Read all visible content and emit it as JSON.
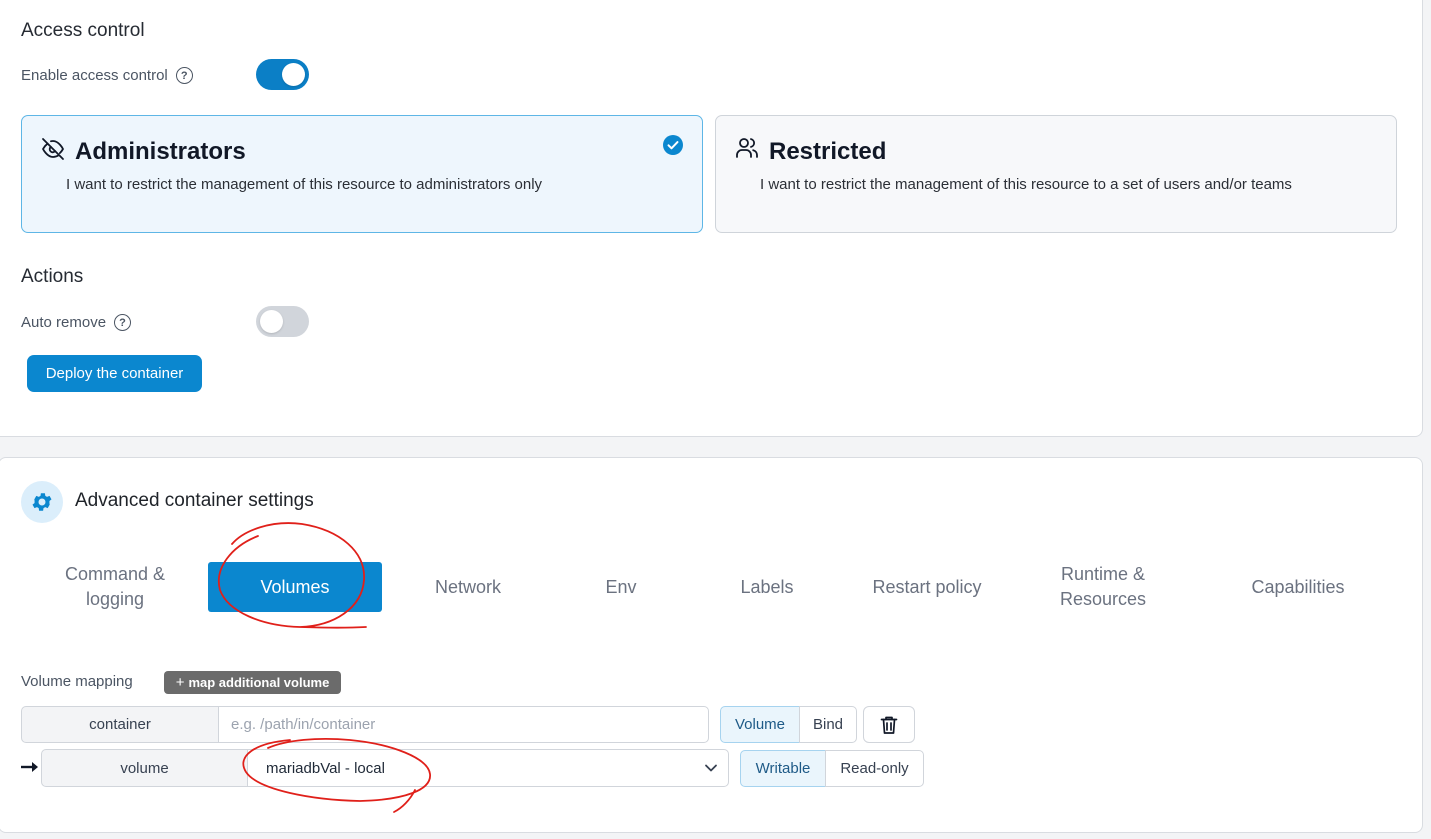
{
  "access_control": {
    "title": "Access control",
    "enable_label": "Enable access control",
    "enabled": true,
    "help_glyph": "?"
  },
  "cards": {
    "administrators": {
      "title": "Administrators",
      "description": "I want to restrict the management of this resource to administrators only",
      "icon": "eye-off-icon",
      "selected": true
    },
    "restricted": {
      "title": "Restricted",
      "description": "I want to restrict the management of this resource to a set of users and/or teams",
      "icon": "users-icon",
      "selected": false
    }
  },
  "actions": {
    "title": "Actions",
    "auto_remove_label": "Auto remove",
    "auto_remove_enabled": false,
    "help_glyph": "?",
    "deploy_button": "Deploy the container"
  },
  "advanced": {
    "title": "Advanced container settings",
    "icon": "gear-icon",
    "tabs": [
      {
        "label": "Command & logging",
        "active": false
      },
      {
        "label": "Volumes",
        "active": true
      },
      {
        "label": "Network",
        "active": false
      },
      {
        "label": "Env",
        "active": false
      },
      {
        "label": "Labels",
        "active": false
      },
      {
        "label": "Restart policy",
        "active": false
      },
      {
        "label": "Runtime & Resources",
        "active": false
      },
      {
        "label": "Capabilities",
        "active": false
      }
    ]
  },
  "volume_mapping": {
    "label": "Volume mapping",
    "add_button": "map additional volume",
    "add_glyph": "+",
    "container_addon": "container",
    "container_placeholder": "e.g. /path/in/container",
    "type_options": [
      "Volume",
      "Bind"
    ],
    "type_selected": "Volume",
    "volume_addon": "volume",
    "volume_selected": "mariadbVal - local",
    "mode_options": [
      "Writable",
      "Read-only"
    ],
    "mode_selected": "Writable"
  },
  "colors": {
    "primary": "#0b87cf",
    "annotation": "#e0201a"
  }
}
